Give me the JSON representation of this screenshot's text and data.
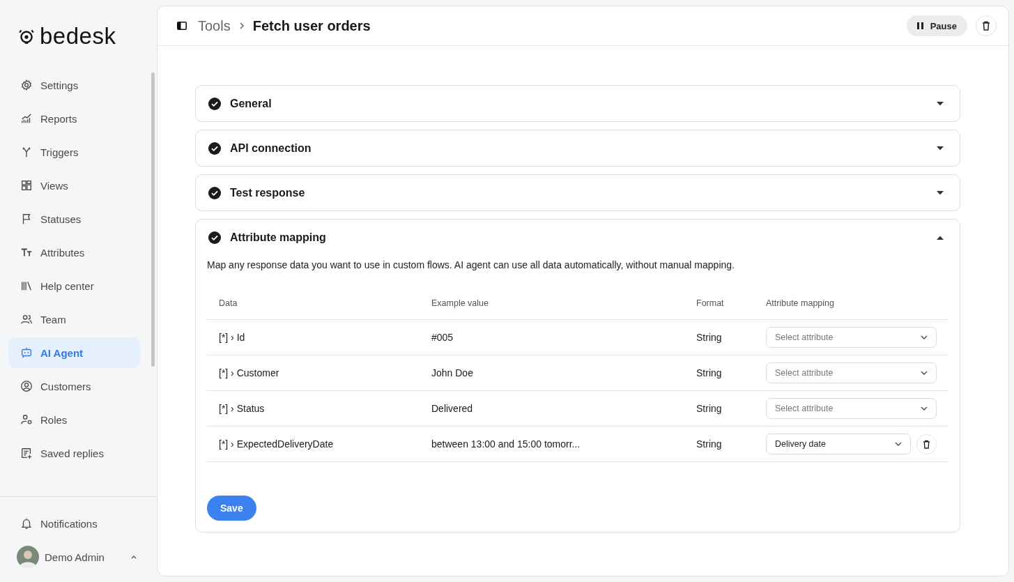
{
  "sidebar": {
    "logo": "bedesk",
    "items": [
      {
        "label": "Settings",
        "selected": false
      },
      {
        "label": "Reports",
        "selected": false
      },
      {
        "label": "Triggers",
        "selected": false
      },
      {
        "label": "Views",
        "selected": false
      },
      {
        "label": "Statuses",
        "selected": false
      },
      {
        "label": "Attributes",
        "selected": false
      },
      {
        "label": "Help center",
        "selected": false
      },
      {
        "label": "Team",
        "selected": false
      },
      {
        "label": "AI Agent",
        "selected": true
      },
      {
        "label": "Customers",
        "selected": false
      },
      {
        "label": "Roles",
        "selected": false
      },
      {
        "label": "Saved replies",
        "selected": false
      }
    ],
    "notifications": "Notifications",
    "user": {
      "name": "Demo Admin"
    }
  },
  "header": {
    "breadcrumb": [
      "Tools",
      "Fetch user orders"
    ],
    "pause_button": "Pause"
  },
  "sections": [
    {
      "title": "General",
      "done": true,
      "expanded": false
    },
    {
      "title": "API connection",
      "done": true,
      "expanded": false
    },
    {
      "title": "Test response",
      "done": true,
      "expanded": false
    },
    {
      "title": "Attribute mapping",
      "done": true,
      "expanded": true
    }
  ],
  "mapping": {
    "description": "Map any response data you want to use in custom flows. AI agent can use all data automatically, without manual mapping.",
    "columns": [
      "Data",
      "Example value",
      "Format",
      "Attribute mapping"
    ],
    "rows": [
      {
        "data": "[*] › Id",
        "example": "#005",
        "format": "String",
        "attribute": {
          "placeholder": "Select attribute"
        },
        "removable": false
      },
      {
        "data": "[*] › Customer",
        "example": "John Doe",
        "format": "String",
        "attribute": {
          "placeholder": "Select attribute"
        },
        "removable": false
      },
      {
        "data": "[*] › Status",
        "example": "Delivered",
        "format": "String",
        "attribute": {
          "placeholder": "Select attribute"
        },
        "removable": false
      },
      {
        "data": "[*] › ExpectedDeliveryDate",
        "example": "between 13:00 and 15:00 tomorr...",
        "format": "String",
        "attribute": {
          "value": "Delivery date"
        },
        "removable": true
      }
    ],
    "save_button": "Save"
  }
}
